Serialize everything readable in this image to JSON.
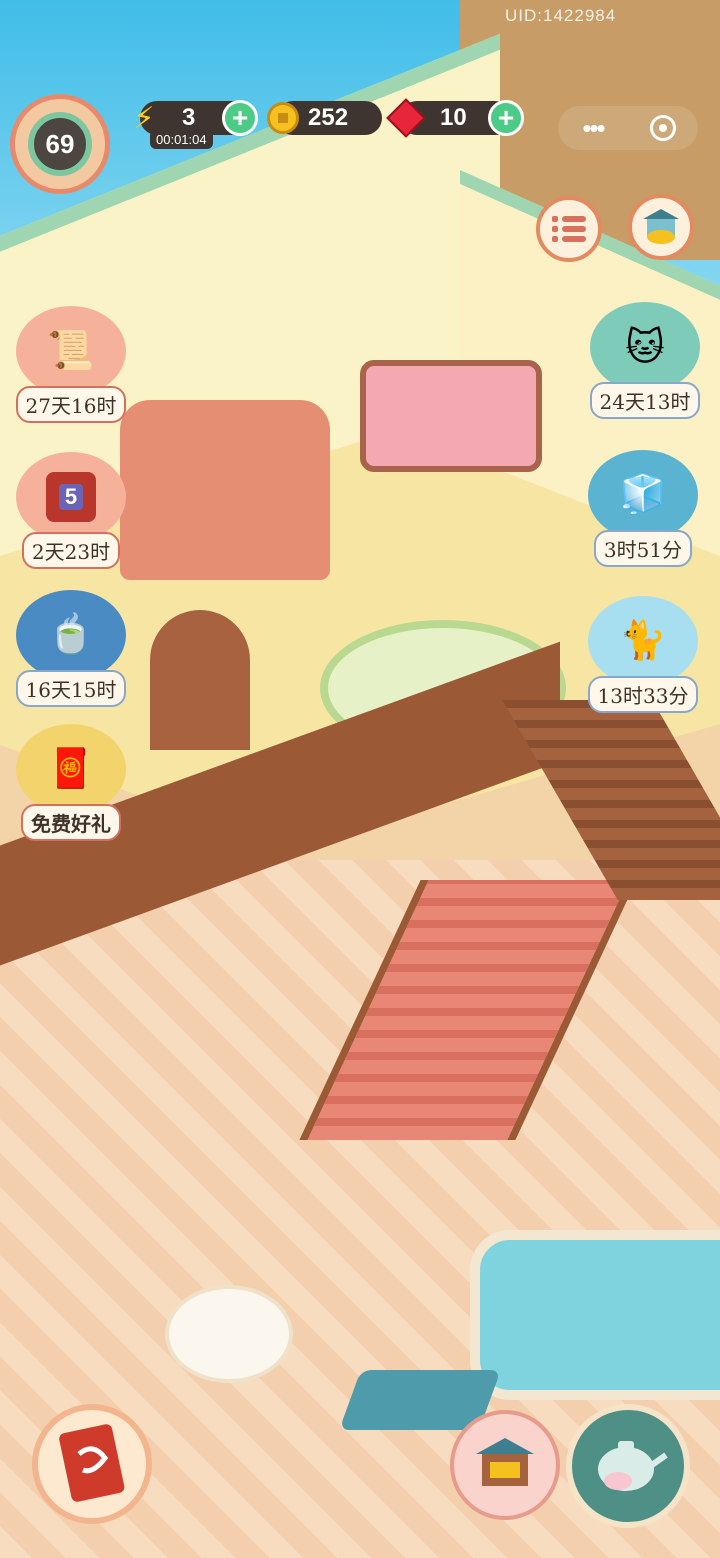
{
  "hud": {
    "uid": "UID:1422984",
    "level": "69",
    "energy": {
      "value": "3",
      "timer": "00:01:04"
    },
    "coins": "252",
    "gems": "10",
    "more_icon": "more-dots-icon",
    "target_icon": "target-circle-icon"
  },
  "top_right": {
    "menu_icon": "list-menu-icon",
    "shop_icon": "treasure-shop-icon"
  },
  "left_events": [
    {
      "name": "event-book",
      "label": "27天16时"
    },
    {
      "name": "event-gift-5",
      "label": "2天23时"
    },
    {
      "name": "event-bowl",
      "label": "16天15时"
    },
    {
      "name": "event-free-gift",
      "label": "免费好礼"
    }
  ],
  "right_events": [
    {
      "name": "event-cat-pond",
      "label": "24天13时"
    },
    {
      "name": "event-ice-box",
      "label": "3时51分"
    },
    {
      "name": "event-ice-cat",
      "label": "13时33分"
    }
  ],
  "gift_badge_number": "5",
  "bottom": {
    "book_icon": "quest-book-icon",
    "shop_stall_icon": "shop-stall-icon",
    "teapot_icon": "teapot-icon"
  },
  "colors": {
    "accent": "#e48a61",
    "pill": "#3e3530",
    "plus": "#4ccb86",
    "sky": "#40bde8"
  }
}
